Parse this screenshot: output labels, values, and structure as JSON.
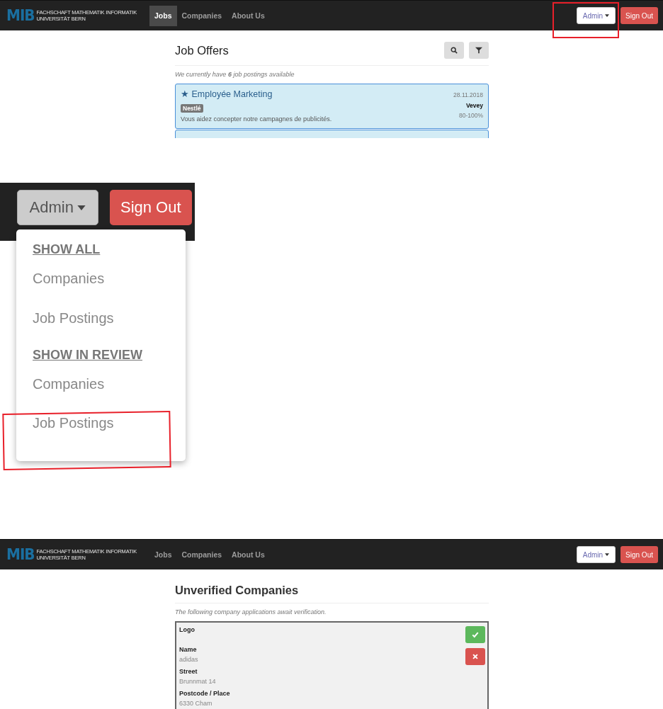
{
  "top_view": {
    "navbar": {
      "logo": "MIB",
      "brand_lines": [
        "FACHSCHAFT MATHEMATIK INFORMATIK",
        "UNIVERSITÄT BERN"
      ],
      "nav_items": [
        {
          "label": "Jobs",
          "selected": true
        },
        {
          "label": "Companies",
          "selected": false
        },
        {
          "label": "About Us",
          "selected": false
        }
      ],
      "admin_button": "Admin",
      "sign_out_button": "Sign Out"
    },
    "page": {
      "title": "Job Offers",
      "subtitle": "We currently have **6** job postings available",
      "job_offers": [
        {
          "star": "★",
          "title": "Employée Marketing",
          "company": "Nestlé",
          "description": "Vous aidez concepter notre campagnes de publicités.",
          "date": "28.11.2018",
          "place": "Vevey",
          "workload": "80-100%"
        }
      ]
    }
  },
  "admin_menu_zoom": {
    "admin_button": "Admin",
    "sign_out_button": "Sign Out",
    "menu": [
      {
        "kind": "header",
        "label": "SHOW ALL"
      },
      {
        "kind": "item",
        "label": "Companies"
      },
      {
        "kind": "item",
        "label": "Job Postings"
      },
      {
        "kind": "header",
        "label": "SHOW IN REVIEW"
      },
      {
        "kind": "item",
        "label": "Companies"
      },
      {
        "kind": "item",
        "label": "Job Postings"
      }
    ]
  },
  "bottom_view": {
    "navbar": {
      "logo": "MIB",
      "brand_lines": [
        "FACHSCHAFT MATHEMATIK INFORMATIK",
        "UNIVERSITÄT BERN"
      ],
      "nav_items": [
        {
          "label": "Jobs",
          "selected": false
        },
        {
          "label": "Companies",
          "selected": false
        },
        {
          "label": "About Us",
          "selected": false
        }
      ],
      "admin_button": "Admin",
      "sign_out_button": "Sign Out"
    },
    "page": {
      "title": "Unverified Companies",
      "subtitle": "The following company applications await verification.",
      "fields": [
        {
          "label": "Logo"
        },
        {
          "label": "Name",
          "value": "adidas"
        },
        {
          "label": "Street",
          "value": "Brunnmat 14"
        },
        {
          "label": "Postcode / Place",
          "value": "6330 Cham"
        }
      ]
    }
  }
}
